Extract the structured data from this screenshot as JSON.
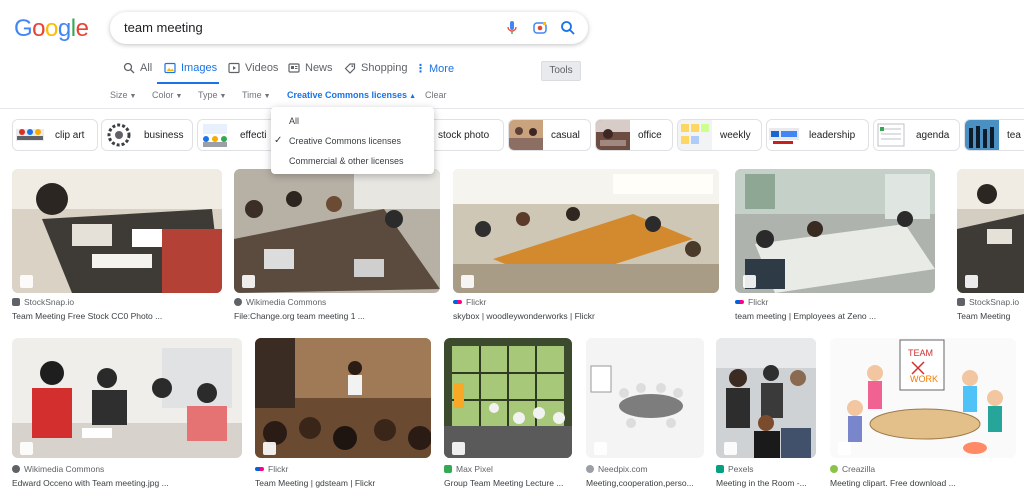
{
  "logo": {
    "letters": [
      "G",
      "o",
      "o",
      "g",
      "l",
      "e"
    ]
  },
  "search": {
    "query": "team meeting"
  },
  "tabs": {
    "all": "All",
    "images": "Images",
    "videos": "Videos",
    "news": "News",
    "shopping": "Shopping",
    "more": "More",
    "tools": "Tools"
  },
  "filters": {
    "size": "Size",
    "color": "Color",
    "type": "Type",
    "time": "Time",
    "license": "Creative Commons licenses",
    "clear": "Clear"
  },
  "dropdown": {
    "items": [
      "All",
      "Creative Commons licenses",
      "Commercial & other licenses"
    ],
    "selected": "Creative Commons licenses"
  },
  "chips": [
    {
      "label": "clip art"
    },
    {
      "label": "business"
    },
    {
      "label": "effecti"
    },
    {
      "label": "stock photo"
    },
    {
      "label": "casual"
    },
    {
      "label": "office"
    },
    {
      "label": "weekly"
    },
    {
      "label": "leadership"
    },
    {
      "label": "agenda"
    },
    {
      "label": "tea"
    }
  ],
  "results": [
    {
      "source": "StockSnap.io",
      "title": "Team Meeting Free Stock CC0 Photo ..."
    },
    {
      "source": "Wikimedia Commons",
      "title": "File:Change.org team meeting 1 ..."
    },
    {
      "source": "Flickr",
      "title": "skybox | woodleywonderworks | Flickr"
    },
    {
      "source": "Flickr",
      "title": "team meeting | Employees at Zeno ..."
    },
    {
      "source": "StockSnap.io",
      "title": "Team Meeting"
    },
    {
      "source": "Wikimedia Commons",
      "title": "Edward Occeno with Team meeting.jpg ..."
    },
    {
      "source": "Flickr",
      "title": "Team Meeting | gdsteam | Flickr"
    },
    {
      "source": "Max Pixel",
      "title": "Group Team Meeting Lecture ..."
    },
    {
      "source": "Needpix.com",
      "title": "Meeting,cooperation,perso..."
    },
    {
      "source": "Pexels",
      "title": "Meeting in the Room -..."
    },
    {
      "source": "Creazilla",
      "title": "Meeting clipart. Free download ..."
    }
  ],
  "thumb_art": {
    "team_text": "TEAM",
    "work_text": "WORK"
  }
}
